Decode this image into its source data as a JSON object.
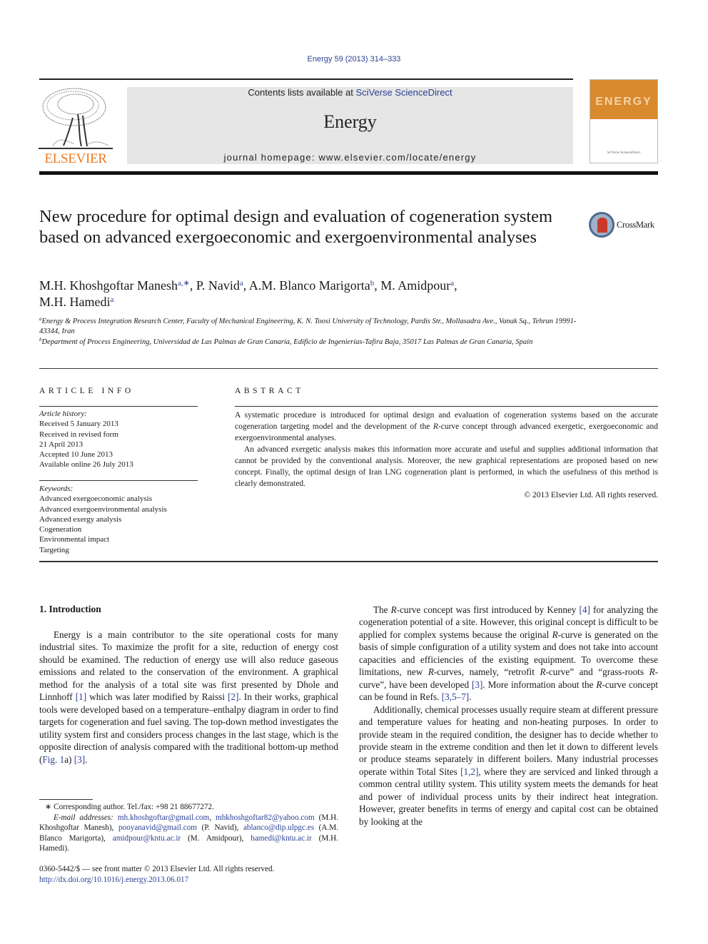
{
  "header": {
    "citation": "Energy 59 (2013) 314–333",
    "contents_prefix": "Contents lists available at ",
    "contents_link": "SciVerse ScienceDirect",
    "journal_name": "Energy",
    "homepage": "journal homepage: www.elsevier.com/locate/energy",
    "publisher_logo_text": "ELSEVIER",
    "cover_title": "ENERGY",
    "cover_publisher": "SciVerse ScienceDirect",
    "crossmark_label": "CrossMark",
    "colors": {
      "link": "#2a3f93",
      "elsevier_orange": "#f07a1e",
      "banner_bg": "#e6e6e6",
      "cover_orange": "#d9892e"
    }
  },
  "article": {
    "title": "New procedure for optimal design and evaluation of cogeneration system based on advanced exergoeconomic and exergoenvironmental analyses",
    "authors": [
      {
        "name": "M.H. Khoshgoftar Manesh",
        "aff": "a,∗",
        "sep": ", "
      },
      {
        "name": "P. Navid",
        "aff": "a",
        "sep": ", "
      },
      {
        "name": "A.M. Blanco Marigorta",
        "aff": "b",
        "sep": ", "
      },
      {
        "name": "M. Amidpour",
        "aff": "a",
        "sep": ","
      },
      {
        "name": "M.H. Hamedi",
        "aff": "a",
        "sep": ""
      }
    ],
    "affiliations": [
      {
        "mark": "a",
        "text": "Energy & Process Integration Research Center, Faculty of Mechanical Engineering, K. N. Toosi University of Technology, Pardis Str., Mollasadra Ave., Vanak Sq., Tehran 19991-43344, Iran"
      },
      {
        "mark": "b",
        "text": "Department of Process Engineering, Universidad de Las Palmas de Gran Canaria, Edificio de Ingenierías-Tafira Baja, 35017 Las Palmas de Gran Canaria, Spain"
      }
    ]
  },
  "article_info": {
    "heading": "ARTICLE INFO",
    "history_label": "Article history:",
    "history": [
      "Received 5 January 2013",
      "Received in revised form",
      "21 April 2013",
      "Accepted 10 June 2013",
      "Available online 26 July 2013"
    ],
    "keywords_label": "Keywords:",
    "keywords": [
      "Advanced exergoeconomic analysis",
      "Advanced exergoenvironmental analysis",
      "Advanced exergy analysis",
      "Cogeneration",
      "Environmental impact",
      "Targeting"
    ]
  },
  "abstract": {
    "heading": "ABSTRACT",
    "p1": "A systematic procedure is introduced for optimal design and evaluation of cogeneration systems based on the accurate cogeneration targeting model and the development of the R-curve concept through advanced exergetic, exergoeconomic and exergoenvironmental analyses.",
    "p2": "An advanced exergetic analysis makes this information more accurate and useful and supplies additional information that cannot be provided by the conventional analysis. Moreover, the new graphical representations are proposed based on new concept. Finally, the optimal design of Iran LNG cogeneration plant is performed, in which the usefulness of this method is clearly demonstrated.",
    "copyright": "© 2013 Elsevier Ltd. All rights reserved."
  },
  "introduction": {
    "heading": "1.  Introduction",
    "left_p1": [
      "Energy is a main contributor to the site operational costs for many industrial sites. To maximize the profit for a site, reduction of energy cost should be examined. The reduction of energy use will also reduce gaseous emissions and related to the conservation of the environment. A graphical method for the analysis of a total site was first presented by Dhole and Linnhoff ",
      "[1]",
      " which was later modified by Raissi ",
      "[2]",
      ". In their works, graphical tools were developed based on a temperature–enthalpy diagram in order to find targets for cogeneration and fuel saving. The top-down method investigates the utility system first and considers process changes in the last stage, which is the opposite direction of analysis compared with the traditional bottom-up method (",
      "Fig. 1",
      "a) ",
      "[3]",
      "."
    ],
    "right_p1": [
      "The ",
      "R",
      "-curve concept was first introduced by Kenney ",
      "[4]",
      " for analyzing the cogeneration potential of a site. However, this original concept is difficult to be applied for complex systems because the original ",
      "R",
      "-curve is generated on the basis of simple configuration of a utility system and does not take into account capacities and efficiencies of the existing equipment. To overcome these limitations, new ",
      "R",
      "-curves, namely, “retrofit ",
      "R",
      "-curve” and “grass-roots ",
      "R",
      "-curve”, have been developed ",
      "[3]",
      ". More information about the ",
      "R",
      "-curve concept can be found in Refs. ",
      "[3,5–7]",
      "."
    ],
    "right_p2": [
      "Additionally, chemical processes usually require steam at different pressure and temperature values for heating and non-heating purposes. In order to provide steam in the required condition, the designer has to decide whether to provide steam in the extreme condition and then let it down to different levels or produce steams separately in different boilers. Many industrial processes operate within Total Sites ",
      "[1,2]",
      ", where they are serviced and linked through a common central utility system. This utility system meets the demands for heat and power of individual process units by their indirect heat integration. However, greater benefits in terms of energy and capital cost can be obtained by looking at the"
    ]
  },
  "footnotes": {
    "corresponding": "∗ Corresponding author. Tel./fax: +98 21 88677272.",
    "email_label": "E-mail addresses:",
    "emails": [
      {
        "addr": "mh.khoshgoftar@gmail.com",
        "after": ", "
      },
      {
        "addr": "mhkhoshgoftar82@yahoo.com",
        "after": " (M.H. Khoshgoftar Manesh), "
      },
      {
        "addr": "pooyanavid@gmail.com",
        "after": " (P. Navid), "
      },
      {
        "addr": "ablanco@dip.ulpgc.es",
        "after": " (A.M. Blanco Marigorta), "
      },
      {
        "addr": "amidpour@kntu.ac.ir",
        "after": " (M. Amidpour), "
      },
      {
        "addr": "hamedi@kntu.ac.ir",
        "after": " (M.H. Hamedi)."
      }
    ],
    "front_matter": "0360-5442/$ — see front matter © 2013 Elsevier Ltd. All rights reserved.",
    "doi": "http://dx.doi.org/10.1016/j.energy.2013.06.017"
  }
}
